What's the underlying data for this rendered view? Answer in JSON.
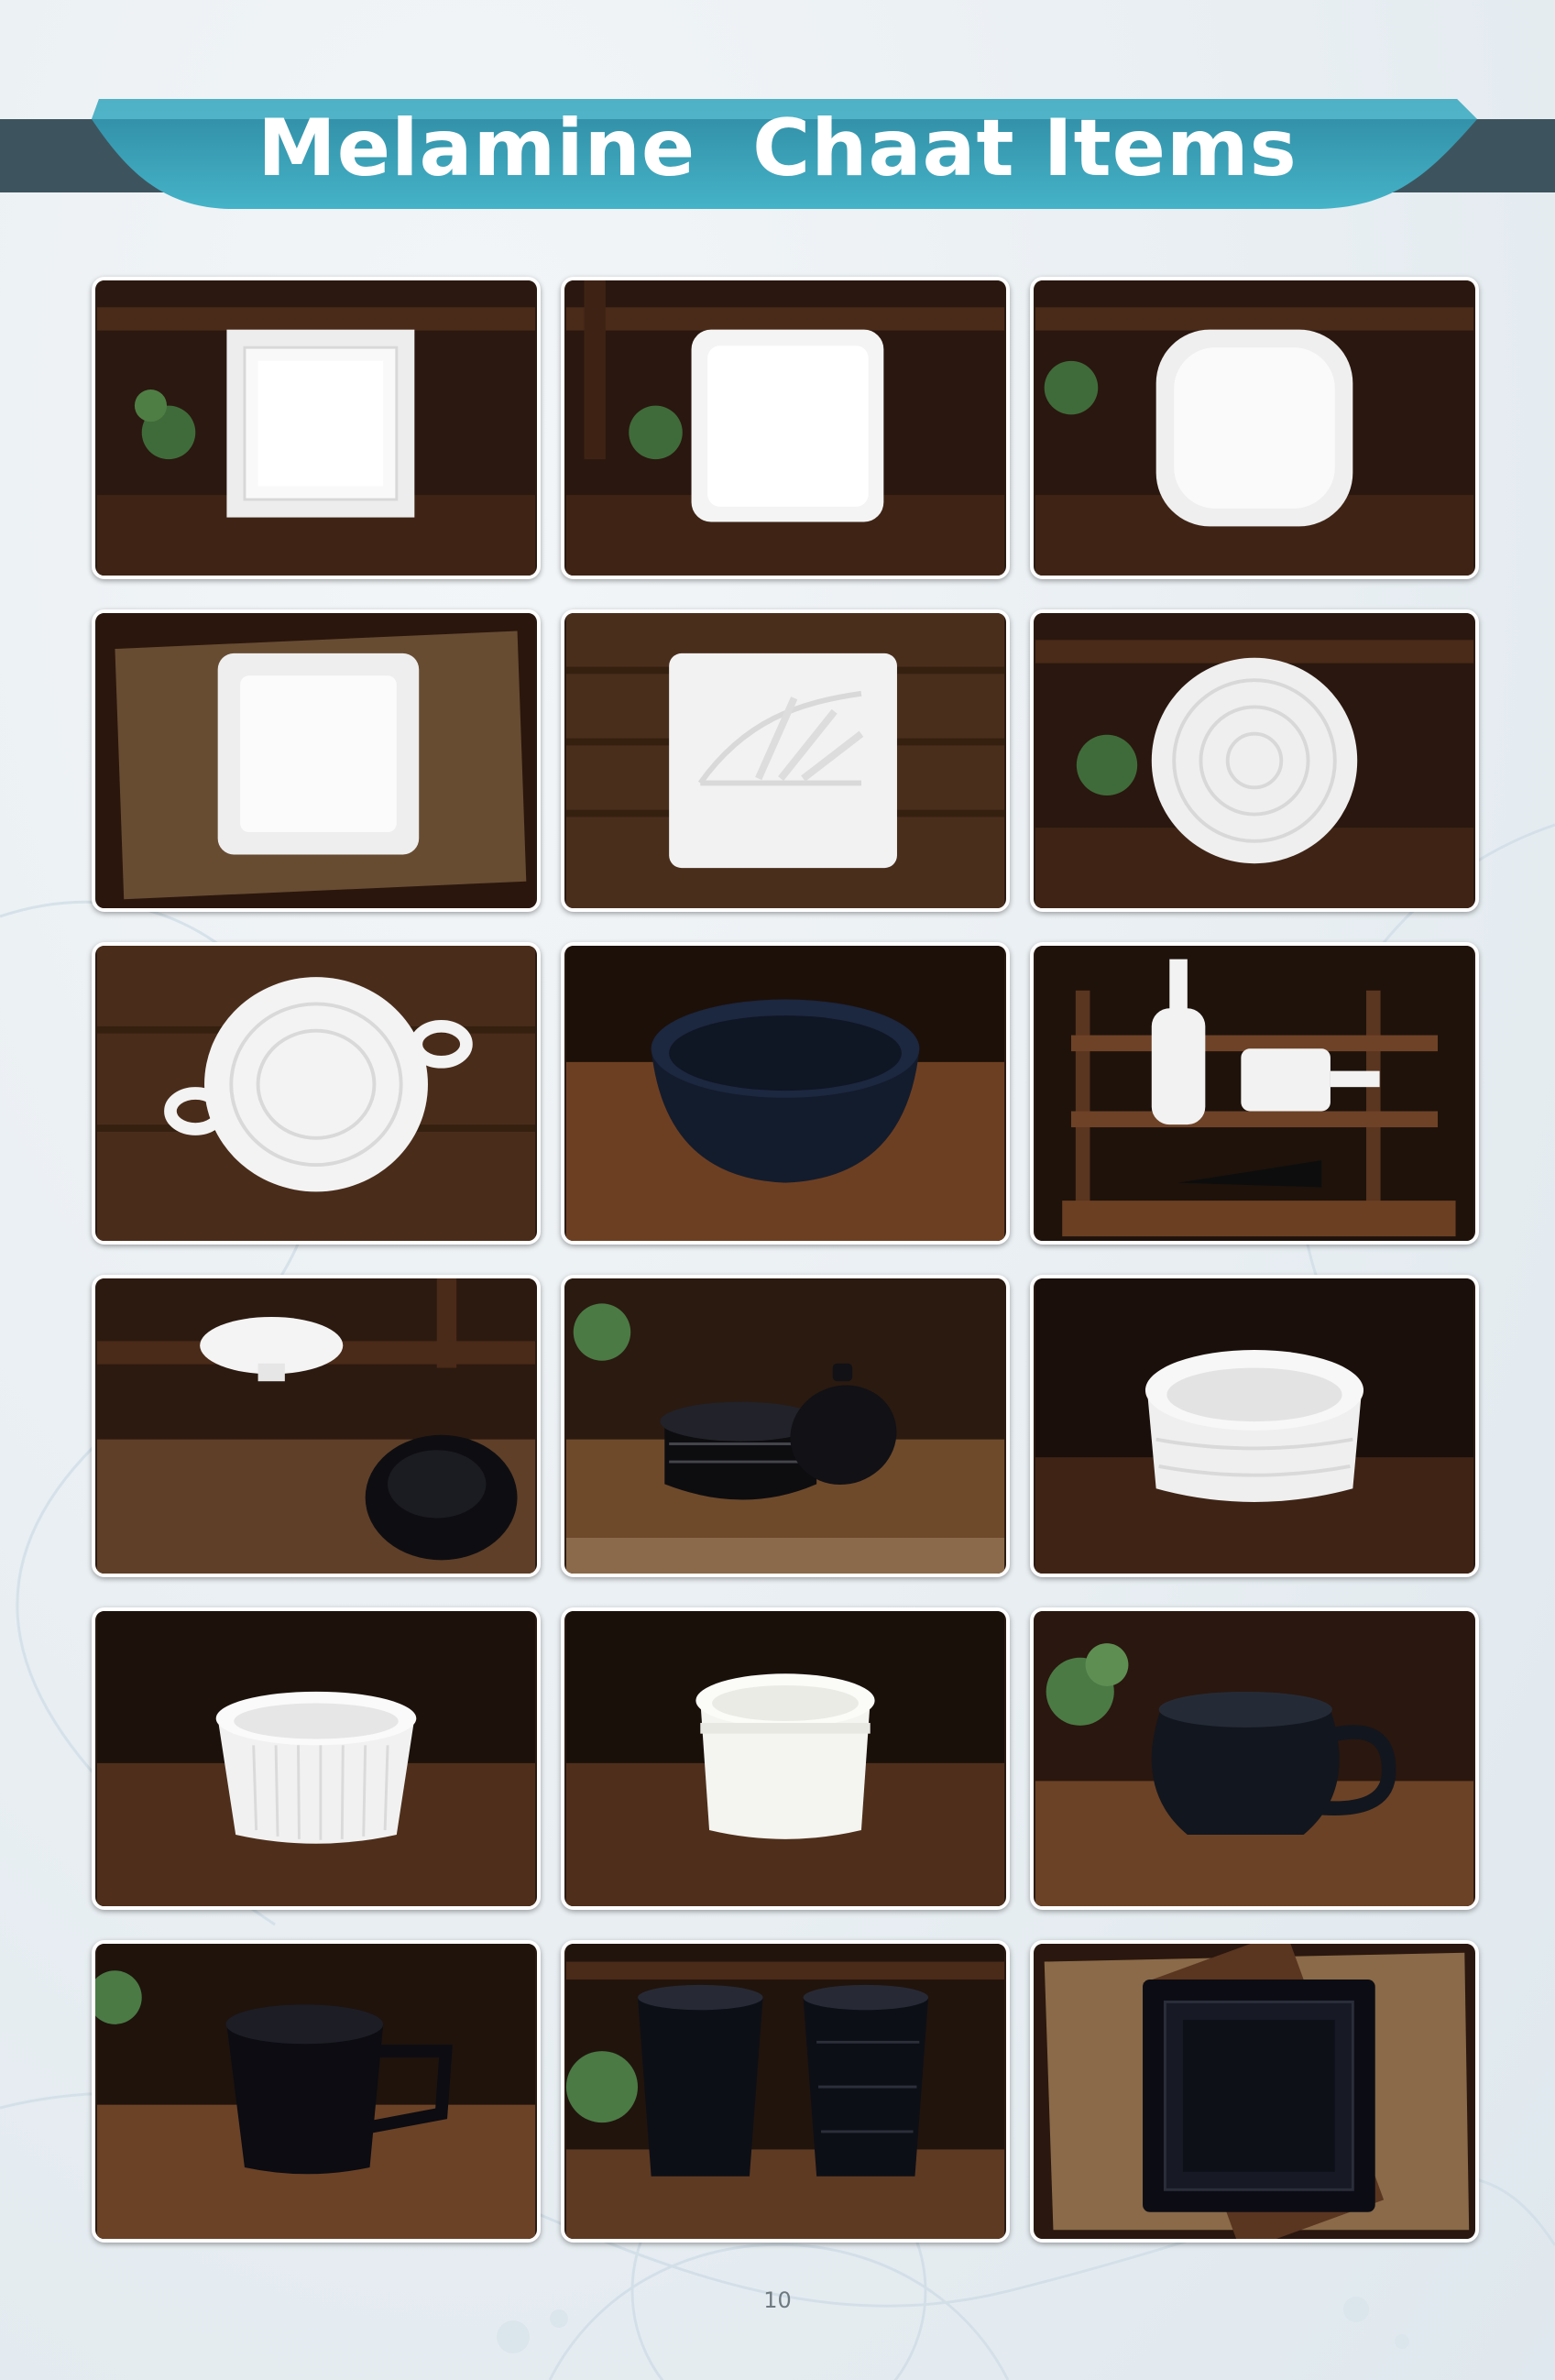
{
  "page": {
    "title": "Melamine  Chaat Items",
    "page_number": "10"
  },
  "products": [
    {
      "type": "square-plate-rimmed",
      "color": "white",
      "backdrop": "shelf"
    },
    {
      "type": "square-plate",
      "color": "white",
      "backdrop": "shelf"
    },
    {
      "type": "square-bowl-rounded",
      "color": "white",
      "backdrop": "shelf"
    },
    {
      "type": "square-deep-bowl",
      "color": "white",
      "backdrop": "burlap"
    },
    {
      "type": "scalloped-sectioned-plate",
      "color": "white",
      "backdrop": "planks"
    },
    {
      "type": "round-ribbed-bowl",
      "color": "white",
      "backdrop": "shelf"
    },
    {
      "type": "two-handle-bowl",
      "color": "white",
      "backdrop": "planks"
    },
    {
      "type": "round-bowl",
      "color": "black",
      "backdrop": "table"
    },
    {
      "type": "bottle-platters",
      "color": "white",
      "backdrop": "rack"
    },
    {
      "type": "footed-dish-and-bowl",
      "color": "white-black",
      "backdrop": "burlap"
    },
    {
      "type": "handi-with-lid",
      "color": "black",
      "backdrop": "table"
    },
    {
      "type": "wave-bowl",
      "color": "white",
      "backdrop": "table"
    },
    {
      "type": "ramekin",
      "color": "white",
      "backdrop": "table"
    },
    {
      "type": "small-cup-bowl",
      "color": "white",
      "backdrop": "table"
    },
    {
      "type": "kulhad-mug",
      "color": "black",
      "backdrop": "table"
    },
    {
      "type": "coffee-cup",
      "color": "black",
      "backdrop": "table"
    },
    {
      "type": "tumblers",
      "color": "black",
      "backdrop": "shelf"
    },
    {
      "type": "square-plate-rimmed",
      "color": "black",
      "backdrop": "burlap"
    }
  ]
}
